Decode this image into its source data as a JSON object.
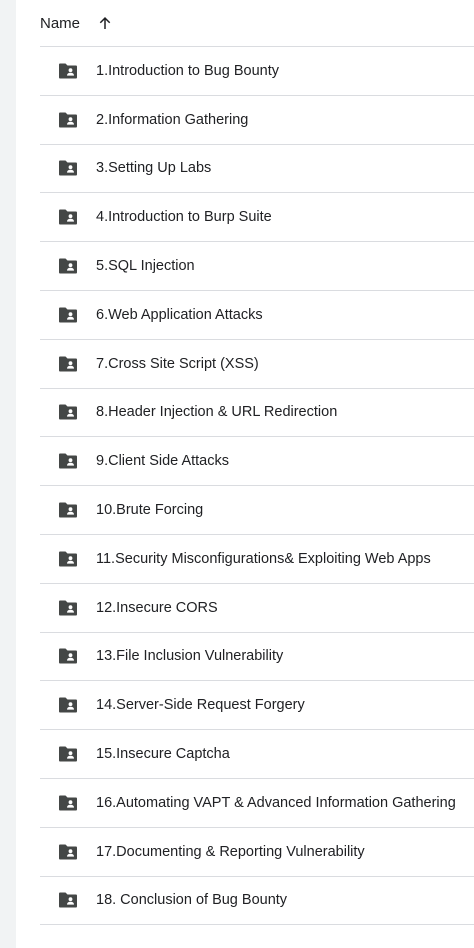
{
  "header": {
    "name_label": "Name",
    "sort_icon": "arrow-up-icon"
  },
  "items": [
    {
      "label": "1.Introduction to Bug Bounty",
      "icon": "shared-folder-icon"
    },
    {
      "label": "2.Information Gathering",
      "icon": "shared-folder-icon"
    },
    {
      "label": "3.Setting Up Labs",
      "icon": "shared-folder-icon"
    },
    {
      "label": "4.Introduction to Burp Suite",
      "icon": "shared-folder-icon"
    },
    {
      "label": "5.SQL Injection",
      "icon": "shared-folder-icon"
    },
    {
      "label": "6.Web Application Attacks",
      "icon": "shared-folder-icon"
    },
    {
      "label": "7.Cross Site Script (XSS)",
      "icon": "shared-folder-icon"
    },
    {
      "label": "8.Header Injection & URL Redirection",
      "icon": "shared-folder-icon"
    },
    {
      "label": "9.Client Side Attacks",
      "icon": "shared-folder-icon"
    },
    {
      "label": "10.Brute Forcing",
      "icon": "shared-folder-icon"
    },
    {
      "label": "11.Security Misconfigurations& Exploiting Web Apps",
      "icon": "shared-folder-icon"
    },
    {
      "label": "12.Insecure CORS",
      "icon": "shared-folder-icon"
    },
    {
      "label": "13.File Inclusion Vulnerability",
      "icon": "shared-folder-icon"
    },
    {
      "label": "14.Server-Side Request Forgery",
      "icon": "shared-folder-icon"
    },
    {
      "label": "15.Insecure Captcha",
      "icon": "shared-folder-icon"
    },
    {
      "label": "16.Automating VAPT & Advanced Information Gathering",
      "icon": "shared-folder-icon"
    },
    {
      "label": "17.Documenting & Reporting Vulnerability",
      "icon": "shared-folder-icon"
    },
    {
      "label": "18. Conclusion of Bug Bounty",
      "icon": "shared-folder-icon"
    }
  ],
  "colors": {
    "text": "#202124",
    "icon": "#444746",
    "divider": "#dadce0",
    "background": "#ffffff"
  }
}
